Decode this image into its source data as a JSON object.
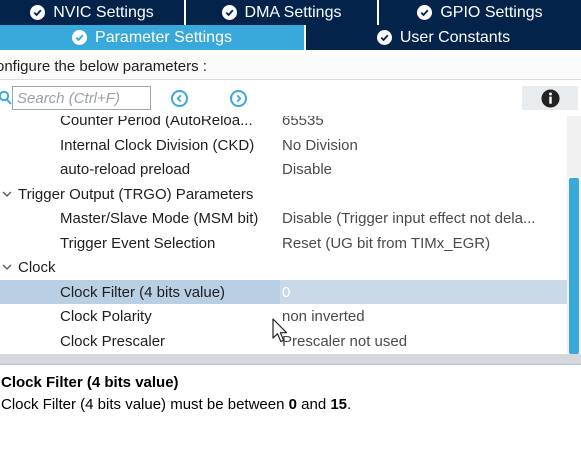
{
  "tabs_row1": [
    {
      "label": "NVIC Settings"
    },
    {
      "label": "DMA Settings"
    },
    {
      "label": "GPIO Settings"
    }
  ],
  "tabs_row2": [
    {
      "label": "Parameter Settings",
      "active": true
    },
    {
      "label": "User Constants",
      "active": false
    }
  ],
  "subtitle": "onfigure the below parameters :",
  "search": {
    "placeholder": "Search (Ctrl+F)"
  },
  "tree": {
    "rows": [
      {
        "label": "Counter Period (AutoReloa...",
        "value": "65535"
      },
      {
        "label": "Internal Clock Division (CKD)",
        "value": "No Division"
      },
      {
        "label": "auto-reload preload",
        "value": "Disable"
      },
      {
        "group": "Trigger Output (TRGO) Parameters"
      },
      {
        "label": "Master/Slave Mode (MSM bit)",
        "value": "Disable (Trigger input effect not dela..."
      },
      {
        "label": "Trigger Event Selection",
        "value": "Reset (UG bit from TIMx_EGR)"
      },
      {
        "group": "Clock"
      },
      {
        "label": "Clock Filter (4 bits value)",
        "value": "0",
        "selected": true
      },
      {
        "label": "Clock Polarity",
        "value": "non inverted"
      },
      {
        "label": "Clock Prescaler",
        "value": "Prescaler not used"
      }
    ]
  },
  "description": {
    "title": "Clock Filter (4 bits value)",
    "text_prefix": "Clock Filter (4 bits value) must be between ",
    "min": "0",
    "text_mid": " and ",
    "max": "15",
    "text_suffix": "."
  },
  "colors": {
    "tab_dark": "#03234b",
    "tab_active": "#39a9dc",
    "selected_row": "#b9cfe3"
  }
}
